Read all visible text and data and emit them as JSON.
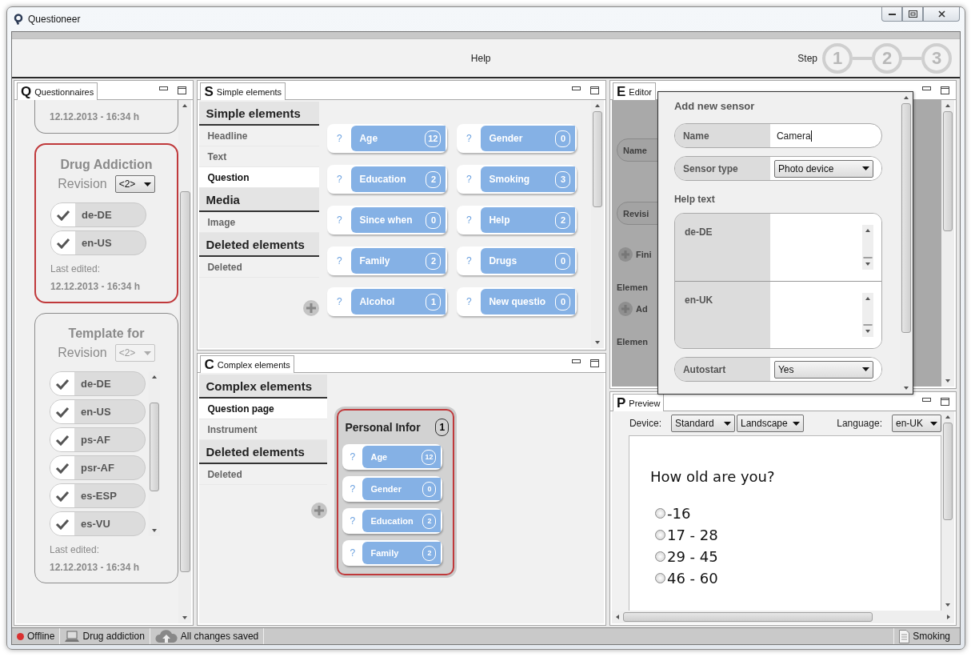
{
  "window": {
    "title": "Questioneer"
  },
  "toolbar": {
    "help": "Help",
    "step_label": "Step",
    "steps": [
      "1",
      "2",
      "3"
    ]
  },
  "questionnaires": {
    "tab": {
      "letter": "Q",
      "title": "Questionnaires"
    },
    "cards": [
      {
        "cut": true,
        "date": "12.12.2013 - 16:34 h",
        "selected": false
      },
      {
        "title": "Drug Addiction",
        "revision_label": "Revision",
        "revision": "<2>",
        "disabled": false,
        "languages": [
          {
            "label": "de-DE",
            "checked": true
          },
          {
            "label": "en-US",
            "checked": true
          }
        ],
        "edited_label": "Last edited:",
        "date": "12.12.2013 - 16:34 h",
        "selected": true
      },
      {
        "title": "Template for",
        "revision_label": "Revision",
        "revision": "<2>",
        "disabled": true,
        "languages": [
          {
            "label": "de-DE",
            "checked": true
          },
          {
            "label": "en-US",
            "checked": true
          },
          {
            "label": "ps-AF",
            "checked": true
          },
          {
            "label": "psr-AF",
            "checked": true
          },
          {
            "label": "es-ESP",
            "checked": true
          },
          {
            "label": "es-VU",
            "checked": true
          }
        ],
        "edited_label": "Last edited:",
        "date": "12.12.2013 - 16:34 h",
        "selected": false
      }
    ]
  },
  "simple": {
    "tab": {
      "letter": "S",
      "title": "Simple elements"
    },
    "sections": [
      {
        "title": "Simple elements",
        "items": [
          {
            "label": "Headline",
            "selected": false
          },
          {
            "label": "Text",
            "selected": false
          },
          {
            "label": "Question",
            "selected": true
          }
        ]
      },
      {
        "title": "Media",
        "items": [
          {
            "label": "Image",
            "selected": false
          }
        ]
      },
      {
        "title": "Deleted elements",
        "items": [
          {
            "label": "Deleted",
            "selected": false
          }
        ]
      }
    ],
    "elements": [
      {
        "mark": "?",
        "label": "Age",
        "count": "12"
      },
      {
        "mark": "?",
        "label": "Gender",
        "count": "0"
      },
      {
        "mark": "?",
        "label": "Education",
        "count": "2"
      },
      {
        "mark": "?",
        "label": "Smoking",
        "count": "3"
      },
      {
        "mark": "?",
        "label": "Since when",
        "count": "0"
      },
      {
        "mark": "?",
        "label": "Help",
        "count": "2"
      },
      {
        "mark": "?",
        "label": "Family",
        "count": "2"
      },
      {
        "mark": "?",
        "label": "Drugs",
        "count": "0"
      },
      {
        "mark": "?",
        "label": "Alcohol",
        "count": "1"
      },
      {
        "mark": "?",
        "label": "New questio",
        "count": "0"
      }
    ]
  },
  "complex": {
    "tab": {
      "letter": "C",
      "title": "Complex elements"
    },
    "sections": [
      {
        "title": "Complex elements",
        "items": [
          {
            "label": "Question page",
            "selected": true
          },
          {
            "label": "Instrument",
            "selected": false
          }
        ]
      },
      {
        "title": "Deleted elements",
        "items": [
          {
            "label": "Deleted",
            "selected": false
          }
        ]
      }
    ],
    "group": {
      "title": "Personal Infor",
      "count": "1",
      "selected": true,
      "items": [
        {
          "mark": "?",
          "label": "Age",
          "count": "12"
        },
        {
          "mark": "?",
          "label": "Gender",
          "count": "0"
        },
        {
          "mark": "?",
          "label": "Education",
          "count": "2"
        },
        {
          "mark": "?",
          "label": "Family",
          "count": "2"
        }
      ]
    }
  },
  "editor": {
    "tab": {
      "letter": "E",
      "title": "Editor"
    },
    "background": [
      {
        "kind": "field",
        "label": "Name"
      },
      {
        "kind": "field",
        "label": "Revisi"
      },
      {
        "kind": "add",
        "label": "Fini"
      },
      {
        "kind": "heading",
        "label": "Elemen"
      },
      {
        "kind": "add",
        "label": "Ad"
      },
      {
        "kind": "heading",
        "label": "Elemen"
      }
    ],
    "dialog": {
      "title": "Add new sensor",
      "name_label": "Name",
      "name_value": "Camera",
      "type_label": "Sensor type",
      "type_value": "Photo device",
      "help_label": "Help text",
      "help_languages": [
        "de-DE",
        "en-UK"
      ],
      "autostart_label": "Autostart",
      "autostart_value": "Yes"
    }
  },
  "preview": {
    "tab": {
      "letter": "P",
      "title": "Preview"
    },
    "device_label": "Device:",
    "device": "Standard",
    "orientation": "Landscape",
    "language_label": "Language:",
    "language": "en-UK",
    "question": "How old are you?",
    "options": [
      {
        "label": "-16",
        "selected": false
      },
      {
        "label": "17 - 28",
        "selected": false
      },
      {
        "label": "29 - 45",
        "selected": false
      },
      {
        "label": "46 - 60",
        "selected": false
      }
    ]
  },
  "status_bar": {
    "items": [
      {
        "kind": "dot",
        "label": "Offline",
        "color": "#d93030"
      },
      {
        "kind": "laptop",
        "label": "Drug addiction"
      },
      {
        "kind": "cloud",
        "label": "All changes saved"
      }
    ],
    "right": {
      "kind": "page",
      "label": "Smoking"
    }
  }
}
